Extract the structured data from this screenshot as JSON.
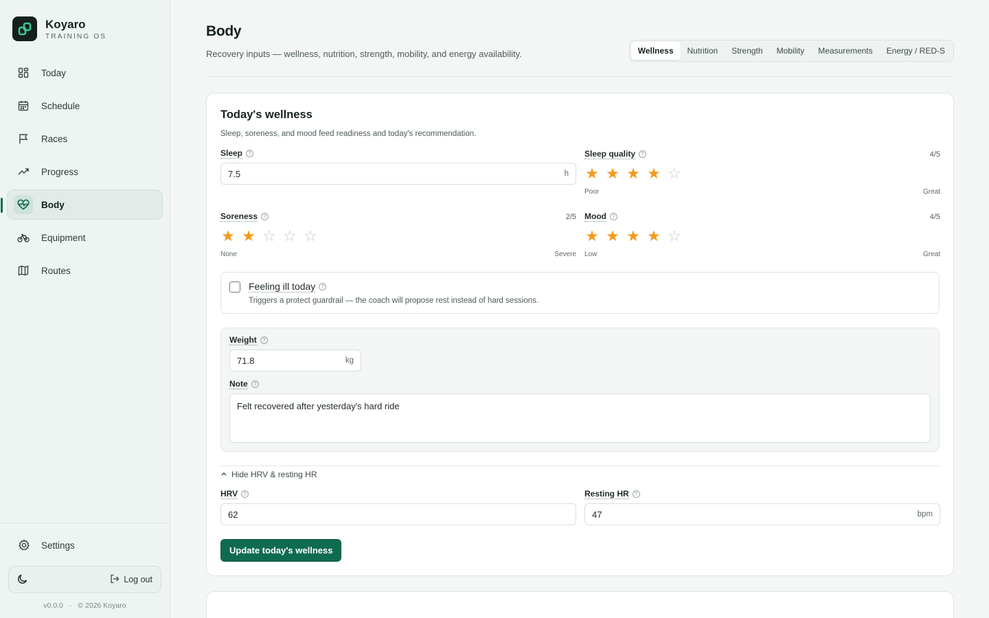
{
  "brand": {
    "name": "Koyaro",
    "tagline": "TRAINING OS"
  },
  "nav": {
    "items": [
      {
        "label": "Today",
        "icon": "dashboard-icon"
      },
      {
        "label": "Schedule",
        "icon": "calendar-icon"
      },
      {
        "label": "Races",
        "icon": "flag-icon"
      },
      {
        "label": "Progress",
        "icon": "trending-up-icon"
      },
      {
        "label": "Body",
        "icon": "heart-pulse-icon",
        "active": true
      },
      {
        "label": "Equipment",
        "icon": "bike-icon"
      },
      {
        "label": "Routes",
        "icon": "map-icon"
      }
    ],
    "settings": "Settings",
    "logout": "Log out",
    "version": "v0.0.0",
    "copyright": "© 2026 Koyaro"
  },
  "page": {
    "title": "Body",
    "subtitle": "Recovery inputs — wellness, nutrition, strength, mobility, and energy availability.",
    "tabs": [
      "Wellness",
      "Nutrition",
      "Strength",
      "Mobility",
      "Measurements",
      "Energy / RED-S"
    ],
    "active_tab": "Wellness"
  },
  "wellness": {
    "title": "Today's wellness",
    "subtitle": "Sleep, soreness, and mood feed readiness and today's recommendation.",
    "sleep": {
      "label": "Sleep",
      "value": "7.5",
      "unit": "h"
    },
    "sleep_quality": {
      "label": "Sleep quality",
      "score": "4/5",
      "rating": 4,
      "min_label": "Poor",
      "max_label": "Great"
    },
    "soreness": {
      "label": "Soreness",
      "score": "2/5",
      "rating": 2,
      "min_label": "None",
      "max_label": "Severe"
    },
    "mood": {
      "label": "Mood",
      "score": "4/5",
      "rating": 4,
      "min_label": "Low",
      "max_label": "Great"
    },
    "ill": {
      "label": "Feeling ill today",
      "description": "Triggers a protect guardrail — the coach will propose rest instead of hard sessions.",
      "checked": false
    },
    "weight": {
      "label": "Weight",
      "value": "71.8",
      "unit": "kg"
    },
    "note": {
      "label": "Note",
      "value": "Felt recovered after yesterday's hard ride"
    },
    "hrv_toggle": "Hide HRV & resting HR",
    "hrv": {
      "label": "HRV",
      "value": "62"
    },
    "resting_hr": {
      "label": "Resting HR",
      "value": "47",
      "unit": "bpm"
    },
    "submit": "Update today's wellness"
  },
  "colors": {
    "accent": "#0f6b50",
    "star": "#f59a1b"
  }
}
